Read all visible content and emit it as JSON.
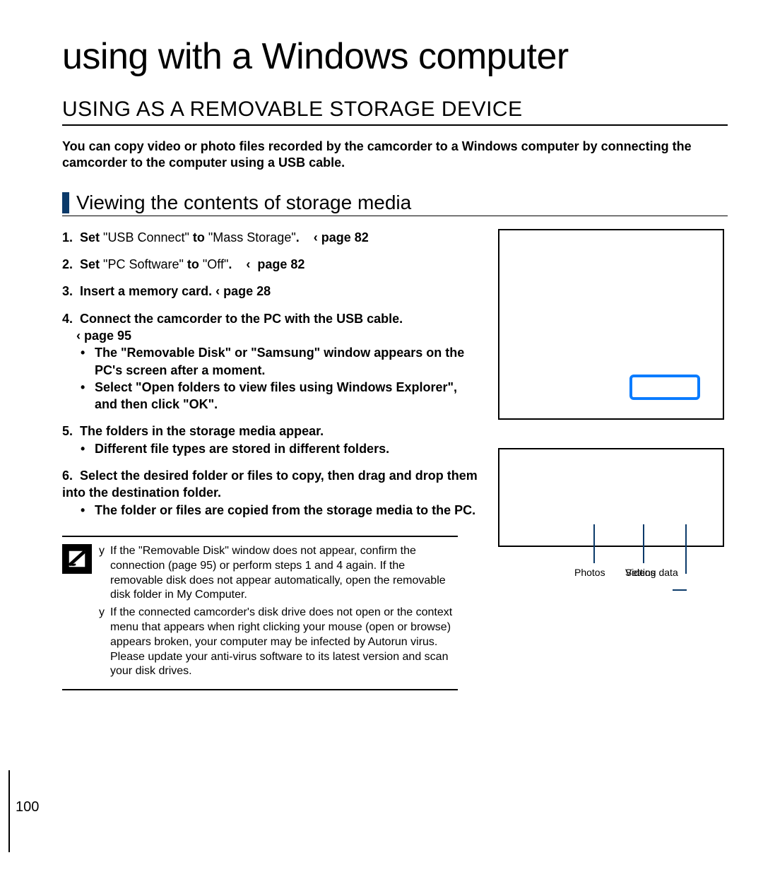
{
  "chapter_title": "using with a Windows computer",
  "section_title": "USING AS A REMOVABLE STORAGE DEVICE",
  "intro": "You can copy video or photo files recorded by the camcorder to a Windows computer by connecting the camcorder to the computer using a USB cable.",
  "subhead": "Viewing the contents of storage media",
  "steps": {
    "s1_pre": "Set",
    "s1_q1": " \"USB Connect\" ",
    "s1_mid": "to",
    "s1_q2": " \"Mass Storage\"",
    "s1_end": ".",
    "s1_ref": "page 82",
    "s2_pre": "Set",
    "s2_q1": " \"PC Software\" ",
    "s2_mid": "to",
    "s2_q2": " \"Off\"",
    "s2_end": ".",
    "s2_ref": "page 82",
    "s3": "Insert a memory card.",
    "s3_ref": "page 28",
    "s4": "Connect the camcorder to the PC with the USB cable.",
    "s4_ref": "page 95",
    "s4_b1": "The \"Removable Disk\" or \"Samsung\" window appears on the PC's screen after a moment.",
    "s4_b2": "Select \"Open folders to view files using Windows Explorer\", and then click \"OK\".",
    "s5": "The folders in the storage media appear.",
    "s5_b1": "Different file types are stored in different folders.",
    "s6": "Select the desired folder or files to copy, then drag and drop them into the destination folder.",
    "s6_b1": "The folder or files are copied from the storage media to the PC."
  },
  "notes": {
    "n1": "If the \"Removable Disk\" window does not appear, confirm the connection (page 95) or perform steps 1 and 4 again. If the removable disk does not appear automatically, open the removable disk folder in My Computer.",
    "n2": "If the connected camcorder's disk drive does not open or the context menu that appears when right clicking your mouse (open or browse) appears broken, your computer may be infected by Autorun virus. Please update your anti-virus software to its latest version and scan your disk drives."
  },
  "callout_labels": {
    "photos": "Photos",
    "videos": "Videos",
    "setting": "Setting data"
  },
  "page_number": "100",
  "arrow_glyph": "‹"
}
